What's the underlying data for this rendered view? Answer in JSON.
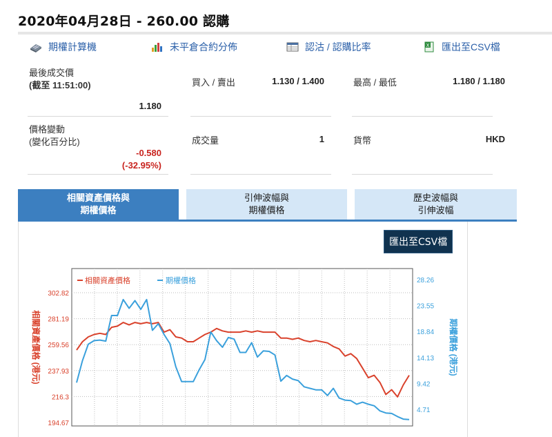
{
  "page_title": "2020年04月28日 - 260.00 認購",
  "toolbar": [
    {
      "label": "期權計算機",
      "icon": "calculator-icon"
    },
    {
      "label": "未平倉合約分佈",
      "icon": "bar-chart-icon"
    },
    {
      "label": "認沽 / 認購比率",
      "icon": "table-icon"
    },
    {
      "label": "匯出至CSV檔",
      "icon": "excel-icon"
    }
  ],
  "quote": {
    "last_price_label": "最後成交價",
    "last_price_time": "(截至 11:51:00)",
    "last_price": "1.180",
    "change_label": "價格變動",
    "change_pct_label": "(變化百分比)",
    "change": "-0.580",
    "change_pct": "(-32.95%)",
    "bid_ask_label": "買入 / 賣出",
    "bid_ask": "1.130 / 1.400",
    "volume_label": "成交量",
    "volume": "1",
    "high_low_label": "最高 / 最低",
    "high_low": "1.180 / 1.180",
    "currency_label": "貨幣",
    "currency": "HKD"
  },
  "tabs": [
    {
      "line1": "相關資產價格與",
      "line2": "期權價格",
      "active": true
    },
    {
      "line1": "引伸波幅與",
      "line2": "期權價格",
      "active": false
    },
    {
      "line1": "歷史波幅與",
      "line2": "引伸波幅",
      "active": false
    }
  ],
  "export_button": "匯出至CSV檔",
  "colors": {
    "accent": "#3c7fc0",
    "series_underlying": "#d9412b",
    "series_option": "#3aa0dc",
    "down": "#c8231e"
  },
  "chart_data": {
    "type": "line",
    "left_axis": {
      "label": "相關資產價格 (港元)",
      "ticks": [
        "302.82",
        "281.19",
        "259.56",
        "237.93",
        "216.3",
        "194.67"
      ],
      "range": [
        194.67,
        302.82
      ]
    },
    "right_axis": {
      "label": "期權價格 (港元)",
      "ticks": [
        "28.26",
        "23.55",
        "18.84",
        "14.13",
        "9.42",
        "4.71"
      ],
      "range": [
        0,
        28.26
      ]
    },
    "series": [
      {
        "name": "相關資產價格",
        "axis": "left",
        "values": [
          255,
          262,
          266,
          268,
          269,
          268,
          274,
          275,
          278,
          276,
          278,
          277,
          278,
          277,
          278,
          270,
          272,
          266,
          265,
          262,
          262,
          265,
          268,
          270,
          273,
          271,
          270,
          270,
          270,
          271,
          270,
          271,
          270,
          270,
          270,
          265,
          265,
          264,
          265,
          263,
          262,
          263,
          262,
          261,
          258,
          256,
          250,
          252,
          248,
          240,
          232,
          234,
          228,
          218,
          222,
          216,
          226,
          234
        ]
      },
      {
        "name": "期權價格",
        "axis": "right",
        "values": [
          8.3,
          12.6,
          15.8,
          16.5,
          16.6,
          16.4,
          21.4,
          21.4,
          24.5,
          22.8,
          24.3,
          22.6,
          24.5,
          18.5,
          19.8,
          17.7,
          15.9,
          11.4,
          8.5,
          8.5,
          8.5,
          10.8,
          12.8,
          18.2,
          16.5,
          15.2,
          17.1,
          16.8,
          14.2,
          14.2,
          16.1,
          13.3,
          14.5,
          14.4,
          13.7,
          8.6,
          9.7,
          9.0,
          8.7,
          7.5,
          7.2,
          6.9,
          6.9,
          5.8,
          7.2,
          5.3,
          4.9,
          4.8,
          4.1,
          4.5,
          4.1,
          3.8,
          2.8,
          2.4,
          2.3,
          1.7,
          1.2,
          1.1
        ]
      }
    ]
  }
}
